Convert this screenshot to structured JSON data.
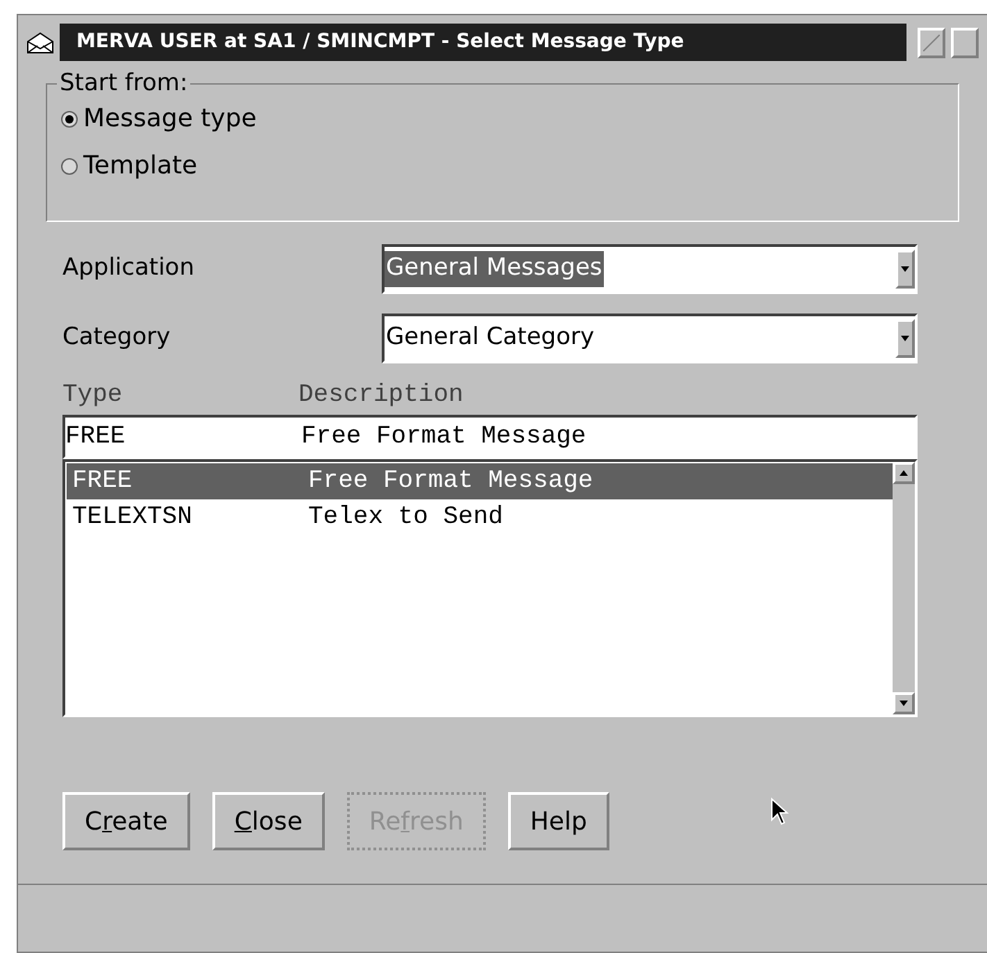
{
  "window": {
    "title": "MERVA USER at SA1 / SMINCMPT - Select Message Type"
  },
  "start_from": {
    "label": "Start from:",
    "options": [
      {
        "label": "Message type",
        "selected": true
      },
      {
        "label": "Template",
        "selected": false
      }
    ]
  },
  "fields": [
    {
      "label": "Application",
      "value": "General Messages",
      "highlighted": true
    },
    {
      "label": "Category",
      "value": "General Category",
      "highlighted": false
    }
  ],
  "list": {
    "columns": [
      "Type",
      "Description"
    ],
    "entry": {
      "type": "FREE",
      "description": "Free Format Message"
    },
    "rows": [
      {
        "type": "FREE",
        "description": "Free Format Message",
        "selected": true
      },
      {
        "type": "TELEXTSN",
        "description": "Telex to Send",
        "selected": false
      }
    ]
  },
  "buttons": [
    {
      "before": "C",
      "mnemonic": "r",
      "after": "eate",
      "disabled": false
    },
    {
      "mnemonic": "C",
      "after": "lose",
      "disabled": false
    },
    {
      "before": "Re",
      "mnemonic": "f",
      "after": "resh",
      "disabled": true
    },
    {
      "before": "Help",
      "disabled": false
    }
  ]
}
